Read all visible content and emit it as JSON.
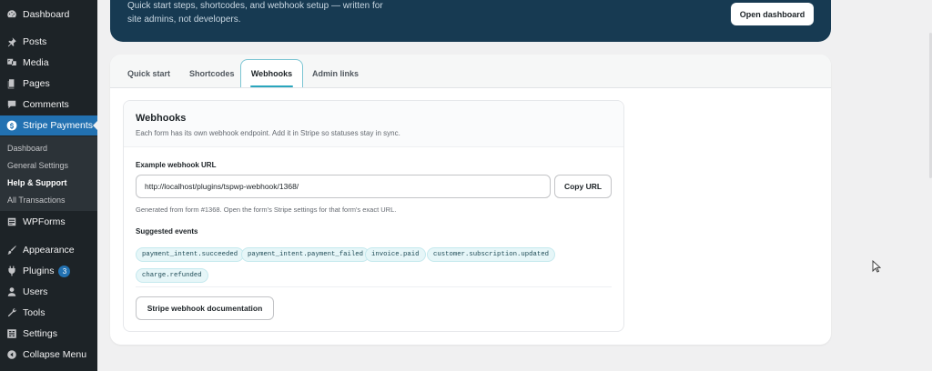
{
  "sidebar": {
    "items": [
      {
        "label": "Dashboard",
        "icon": "dashboard-icon"
      },
      {
        "label": "Posts",
        "icon": "pin-icon"
      },
      {
        "label": "Media",
        "icon": "media-icon"
      },
      {
        "label": "Pages",
        "icon": "pages-icon"
      },
      {
        "label": "Comments",
        "icon": "comment-icon"
      },
      {
        "label": "Stripe Payments",
        "icon": "dollar-icon"
      },
      {
        "label": "WPForms",
        "icon": "form-icon"
      },
      {
        "label": "Appearance",
        "icon": "brush-icon"
      },
      {
        "label": "Plugins",
        "icon": "plug-icon",
        "badge": "3"
      },
      {
        "label": "Users",
        "icon": "user-icon"
      },
      {
        "label": "Tools",
        "icon": "wrench-icon"
      },
      {
        "label": "Settings",
        "icon": "settings-icon"
      },
      {
        "label": "Collapse Menu",
        "icon": "collapse-icon"
      }
    ],
    "submenu": [
      "Dashboard",
      "General Settings",
      "Help & Support",
      "All Transactions"
    ],
    "current_submenu": "Help & Support"
  },
  "hero": {
    "text": "Quick start steps, shortcodes, and webhook setup — written for site admins, not developers.",
    "button": "Open dashboard"
  },
  "tabs": [
    "Quick start",
    "Shortcodes",
    "Webhooks",
    "Admin links"
  ],
  "active_tab": "Webhooks",
  "webhooks": {
    "title": "Webhooks",
    "subtitle": "Each form has its own webhook endpoint. Add it in Stripe so statuses stay in sync.",
    "url_label": "Example webhook URL",
    "url_value": "http://localhost/plugins/tspwp-webhook/1368/",
    "copy_button": "Copy URL",
    "help_text": "Generated from form #1368. Open the form's Stripe settings for that form's exact URL.",
    "events_label": "Suggested events",
    "events": [
      "payment_intent.succeeded",
      "payment_intent.payment_failed",
      "invoice.paid",
      "customer.subscription.updated",
      "charge.refunded"
    ],
    "docs_button": "Stripe webhook documentation"
  },
  "colors": {
    "sidebar_bg": "#1d2327",
    "sidebar_active": "#2271b1",
    "hero_bg": "#173a52",
    "tab_accent": "#2aa6bd",
    "chip_bg": "#e6f6f8"
  }
}
